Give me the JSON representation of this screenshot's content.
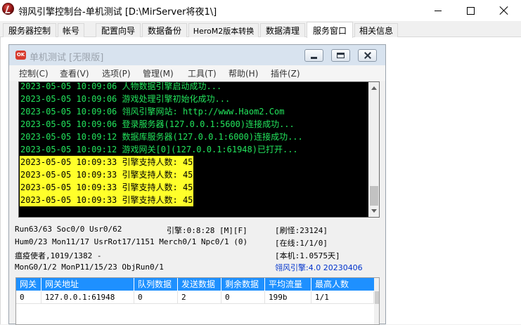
{
  "window": {
    "title": "翎风引擎控制台-单机测试 [D:\\MirServer将夜1\\]"
  },
  "tabs": [
    {
      "label": "服务器控制",
      "active": false
    },
    {
      "label": "帐号",
      "active": false
    },
    {
      "label": "配置向导",
      "active": false
    },
    {
      "label": "数据备份",
      "active": false
    },
    {
      "label": "HeroM2版本转换",
      "active": false
    },
    {
      "label": "数据清理",
      "active": false
    },
    {
      "label": "服务窗口",
      "active": true
    },
    {
      "label": "相关信息",
      "active": false
    }
  ],
  "child_window": {
    "icon_text": "OK",
    "title": "单机测试 [无限版]",
    "menu": [
      "控制(C)",
      "查看(V)",
      "选项(P)",
      "管理(M)",
      "工具(T)",
      "帮助(H)",
      "插件(Z)"
    ]
  },
  "log": [
    {
      "text": "2023-05-05 10:09:06 人物数据引擎启动成功...",
      "style": "green"
    },
    {
      "text": "2023-05-05 10:09:06 游戏处理引擎初始化成功...",
      "style": "green"
    },
    {
      "text": "2023-05-05 10:09:06 翎风引擎网站: http://www.Haom2.Com",
      "style": "green"
    },
    {
      "text": "2023-05-05 10:09:06 登录服务器(127.0.0.1:5600)连接成功...",
      "style": "green"
    },
    {
      "text": "2023-05-05 10:09:12 数据库服务器(127.0.0.1:6000)连接成功...",
      "style": "green"
    },
    {
      "text": "2023-05-05 10:09:12 游戏网关[0](127.0.0.1:61948)已打开...",
      "style": "green"
    },
    {
      "text": "2023-05-05 10:09:33 引擎支持人数: 45",
      "style": "yellow"
    },
    {
      "text": "2023-05-05 10:09:33 引擎支持人数: 45",
      "style": "yellow"
    },
    {
      "text": "2023-05-05 10:09:33 引擎支持人数: 45",
      "style": "yellow"
    },
    {
      "text": "2023-05-05 10:09:33 引擎支持人数: 45",
      "style": "yellow"
    }
  ],
  "status": {
    "run": "Run63/63 Soc0/0 Usr0/62",
    "engine_time": "引擎:0:8:28 [M][F]",
    "refresh": "[刷怪:23124]",
    "hum": "Hum0/23 Mon11/17 UsrRot17/1151 Merch0/1 Npc0/1 (0)",
    "online": "[在线:1/1/0]",
    "monster": "瘟疫使者,1019/1382 -",
    "local": "[本机:1.0575天]",
    "mongo": "MonG0/1/2 MonP11/15/23 ObjRun0/1",
    "version": "翎风引擎:4.0 20230406"
  },
  "grid": {
    "columns": [
      "网关",
      "网关地址",
      "队列数据",
      "发送数据",
      "剩余数据",
      "平均流量",
      "最高人数"
    ],
    "rows": [
      [
        "0",
        "127.0.0.1:61948",
        "0",
        "2",
        "0",
        "199b",
        "1/1"
      ]
    ]
  },
  "colors": {
    "console_green": "#22e45c",
    "highlight_yellow": "#ffff2a",
    "grid_header_blue": "#1e90ff",
    "version_blue": "#0033cc"
  },
  "icons": [
    "app-logo-icon",
    "minimize-icon",
    "maximize-icon",
    "close-icon"
  ]
}
